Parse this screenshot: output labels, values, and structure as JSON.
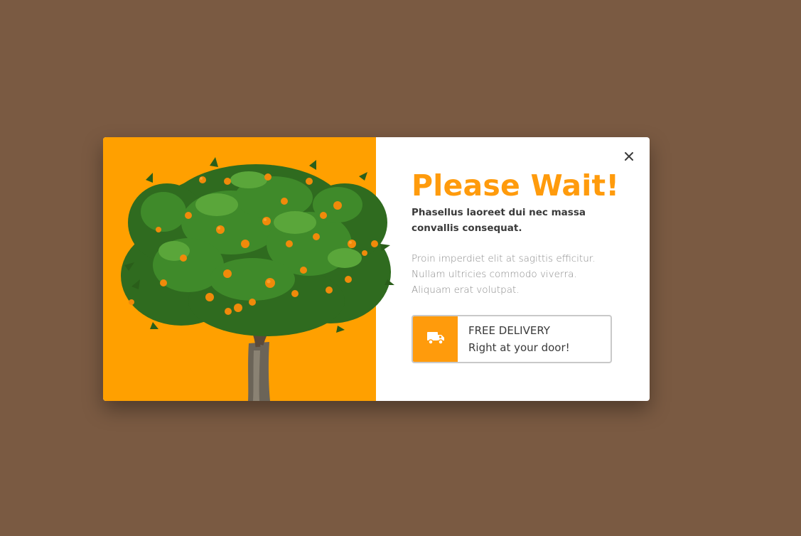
{
  "popup": {
    "title": "Please Wait!",
    "subtitle": "Phasellus laoreet dui nec massa convallis consequat.",
    "body": "Proin imperdiet elit at sagittis efficitur. Nullam ultricies commodo viverra. Aliquam erat volutpat.",
    "close_icon": "close-icon",
    "image_subject": "orange-tree",
    "delivery": {
      "icon": "truck-icon",
      "headline": "FREE DELIVERY",
      "tagline": "Right at your door!"
    }
  },
  "colors": {
    "page_background": "#7a5a42",
    "accent": "#ff9b0c",
    "image_background": "#ffa000",
    "text_dark": "#3a3a3a",
    "text_muted": "#8a8a8a"
  }
}
